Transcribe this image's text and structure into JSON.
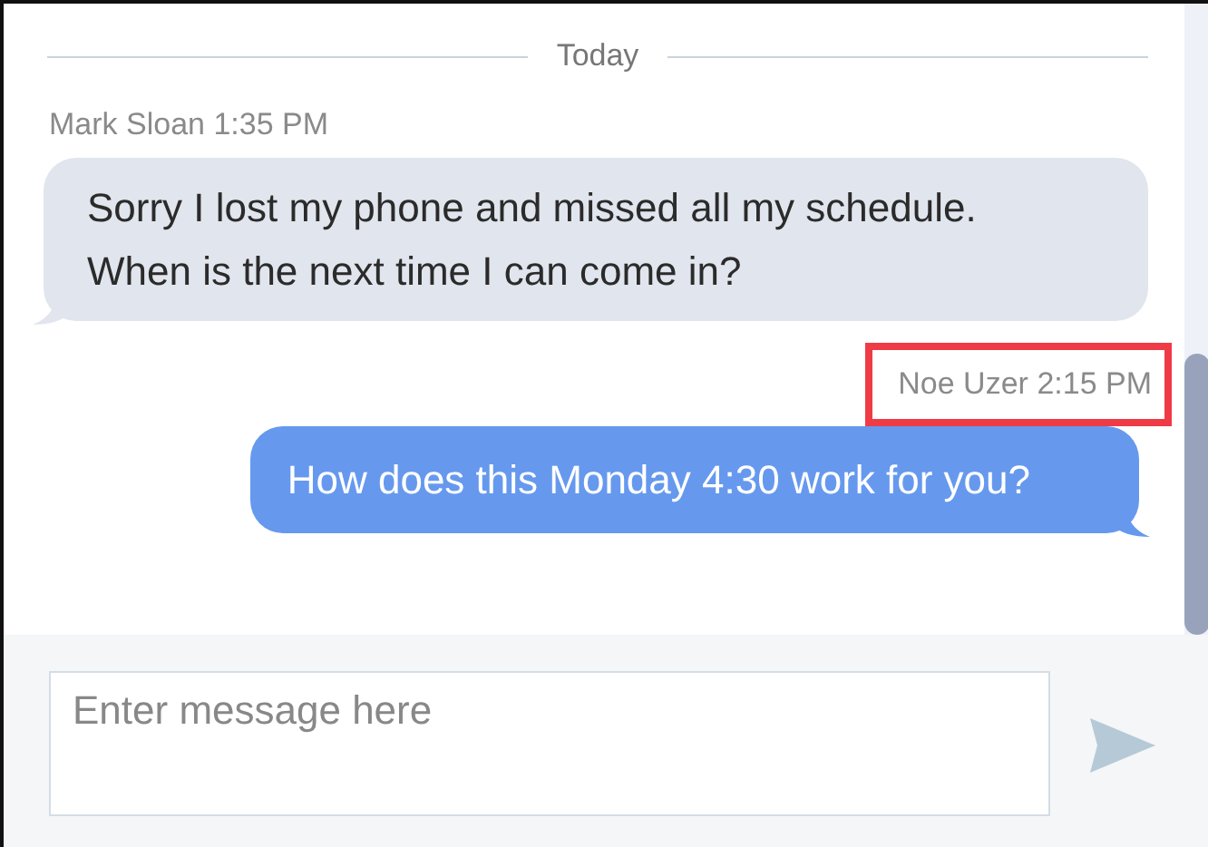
{
  "date_divider": "Today",
  "messages": [
    {
      "kind": "incoming",
      "sender": "Mark Sloan",
      "time": "1:35 PM",
      "highlighted": false,
      "lines": [
        "Sorry I lost my phone and missed all my schedule.",
        "When is the next time I can come in?"
      ]
    },
    {
      "kind": "outgoing",
      "sender": "Noe Uzer",
      "time": "2:15 PM",
      "highlighted": true,
      "lines": [
        "How does this Monday 4:30 work for you?"
      ]
    }
  ],
  "composer": {
    "placeholder": "Enter message here"
  }
}
